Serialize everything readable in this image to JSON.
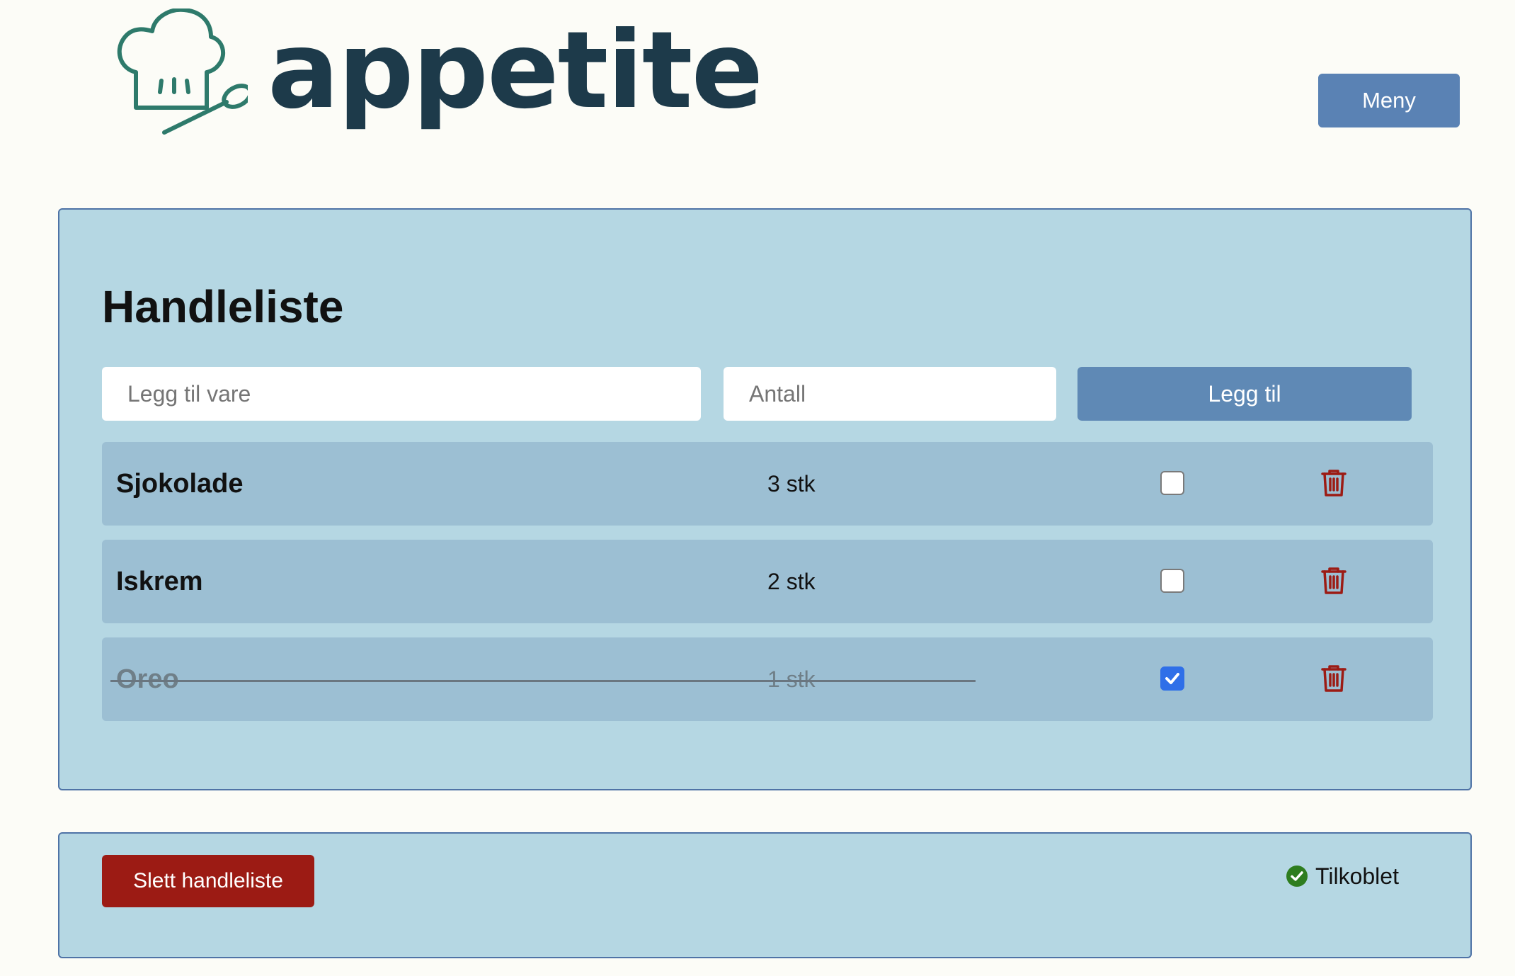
{
  "header": {
    "brand": "appetite",
    "menu_label": "Meny"
  },
  "shopping_list": {
    "title": "Handleliste",
    "item_placeholder": "Legg til vare",
    "quantity_placeholder": "Antall",
    "add_label": "Legg til",
    "items": [
      {
        "name": "Sjokolade",
        "quantity": "3 stk",
        "checked": false
      },
      {
        "name": "Iskrem",
        "quantity": "2 stk",
        "checked": false
      },
      {
        "name": "Oreo",
        "quantity": "1 stk",
        "checked": true
      }
    ]
  },
  "footer": {
    "delete_label": "Slett handleliste",
    "status_text": "Tilkoblet",
    "status_icon": "check-circle-icon"
  },
  "colors": {
    "brand": "#1d3a4a",
    "logo": "#2e7a6b",
    "card_bg": "#b5d7e3",
    "row_bg": "#9cbfd3",
    "primary_button": "#5a82b4",
    "danger_button": "#9c1b14",
    "trash_icon": "#9c1b14",
    "status_ok": "#2e7d1f",
    "checkbox_checked": "#2f6fe8"
  }
}
